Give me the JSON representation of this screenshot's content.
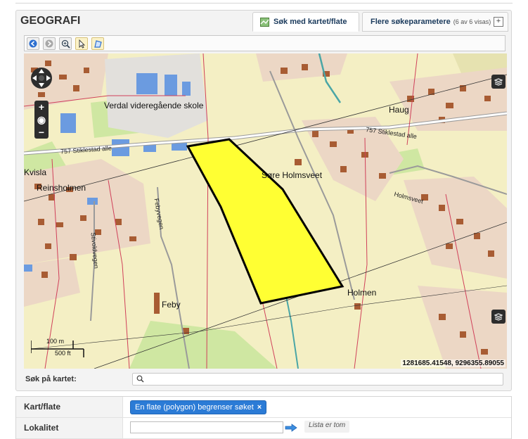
{
  "panel": {
    "title": "GEOGRAFI",
    "tabs": [
      {
        "label": "Søk med kartet/flate",
        "icon": "map-icon",
        "active": true
      },
      {
        "label": "Flere søkeparametere",
        "note": "(6 av 6 visas)",
        "icon": "plus-icon",
        "active": false
      }
    ]
  },
  "toolbar": {
    "tools": [
      "back-icon",
      "forward-icon",
      "zoom-icon",
      "pointer-icon",
      "polygon-draw-icon"
    ],
    "active_tools": [
      "pointer-icon",
      "polygon-draw-icon"
    ]
  },
  "map": {
    "place_labels": [
      "Verdal videregående skole",
      "Haug",
      "Kvisla",
      "Reinsholmen",
      "Søre Holmsveet",
      "Feby",
      "Holmen"
    ],
    "street_labels": [
      "757 Stiklestad alle",
      "757 Stiklestad alle",
      "Holmsveet",
      "Febyvegen",
      "Stivoldvegen"
    ],
    "scale": {
      "metric": "100 m",
      "imperial": "500 ft"
    },
    "coordinates": "1281685.41548, 9296355.89055",
    "polygon_fill": "#ffff33",
    "controls": [
      "pan-icon",
      "zoom-in-icon",
      "globe-icon",
      "zoom-out-icon",
      "layers-icon"
    ]
  },
  "map_search": {
    "label": "Søk på kartet:",
    "placeholder": ""
  },
  "criteria": [
    {
      "label": "Kart/flate",
      "chip": "En flate (polygon) begrenser søket",
      "chip_remove": "×"
    },
    {
      "label": "Lokalitet",
      "input_value": "",
      "note": "Lista er tom"
    }
  ],
  "colors": {
    "accent": "#2b7bd6",
    "polygon": "#ffff33",
    "map_base": "#f4efc4"
  }
}
